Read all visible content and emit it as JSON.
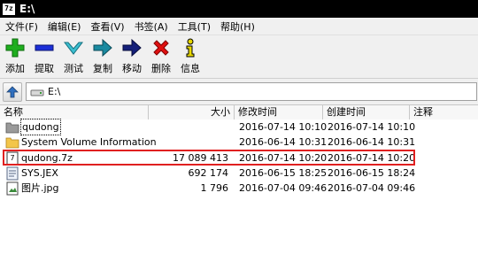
{
  "window": {
    "title": "E:\\",
    "app_icon_text": "7z"
  },
  "menu": [
    "文件(F)",
    "编辑(E)",
    "查看(V)",
    "书签(A)",
    "工具(T)",
    "帮助(H)"
  ],
  "toolbar": [
    {
      "label": "添加",
      "icon": "add-icon",
      "color": "#1fae1f"
    },
    {
      "label": "提取",
      "icon": "extract-icon",
      "color": "#1c2fd8"
    },
    {
      "label": "测试",
      "icon": "test-icon",
      "color": "#3bbfd0"
    },
    {
      "label": "复制",
      "icon": "copy-icon",
      "color": "#1a8aa0"
    },
    {
      "label": "移动",
      "icon": "move-icon",
      "color": "#15207a"
    },
    {
      "label": "删除",
      "icon": "delete-icon",
      "color": "#e01010"
    },
    {
      "label": "信息",
      "icon": "info-icon",
      "color": "#e8d800"
    }
  ],
  "address": {
    "path": "E:\\"
  },
  "columns": {
    "name": "名称",
    "size": "大小",
    "modified": "修改时间",
    "created": "创建时间",
    "comment": "注释"
  },
  "files": [
    {
      "name": "qudong",
      "size": "",
      "modified": "2016-07-14 10:10",
      "created": "2016-07-14 10:10",
      "icon": "folder-dark-icon",
      "selected": true
    },
    {
      "name": "System Volume Information",
      "size": "",
      "modified": "2016-06-14 10:31",
      "created": "2016-06-14 10:31",
      "icon": "folder-icon"
    },
    {
      "name": "qudong.7z",
      "size": "17 089 413",
      "modified": "2016-07-14 10:20",
      "created": "2016-07-14 10:20",
      "icon": "archive-icon",
      "highlighted": true
    },
    {
      "name": "SYS.JEX",
      "size": "692 174",
      "modified": "2016-06-15 18:25",
      "created": "2016-06-15 18:24",
      "icon": "file-icon"
    },
    {
      "name": "图片.jpg",
      "size": "1 796",
      "modified": "2016-07-04 09:46",
      "created": "2016-07-04 09:46",
      "icon": "image-icon"
    }
  ],
  "colors": {
    "titlebar": "#000000",
    "highlight_border": "#e02020",
    "folder": "#f3c64a"
  }
}
